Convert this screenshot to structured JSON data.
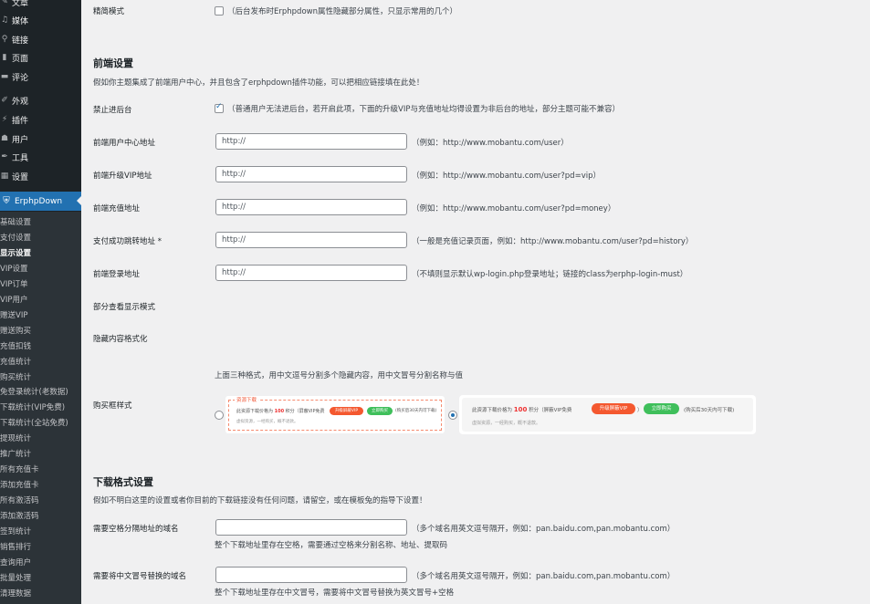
{
  "sidebar": {
    "top_items": [
      {
        "label": "文章",
        "icon": "pushpin-icon"
      },
      {
        "label": "媒体",
        "icon": "media-icon"
      },
      {
        "label": "链接",
        "icon": "link-icon"
      },
      {
        "label": "页面",
        "icon": "page-icon"
      },
      {
        "label": "评论",
        "icon": "comment-icon"
      },
      {
        "label": "外观",
        "icon": "brush-icon"
      },
      {
        "label": "插件",
        "icon": "plugin-icon"
      },
      {
        "label": "用户",
        "icon": "user-icon"
      },
      {
        "label": "工具",
        "icon": "wrench-icon"
      },
      {
        "label": "设置",
        "icon": "settings-icon"
      }
    ],
    "current": {
      "label": "ErphpDown",
      "icon": "shield-icon"
    },
    "submenu": [
      "基础设置",
      "支付设置",
      "显示设置",
      "VIP设置",
      "VIP订单",
      "VIP用户",
      "赠送VIP",
      "赠送购买",
      "充值扣钱",
      "充值统计",
      "购买统计",
      "免登录统计(老数据)",
      "下载统计(VIP免费)",
      "下载统计(全站免费)",
      "提现统计",
      "推广统计",
      "所有充值卡",
      "添加充值卡",
      "所有激活码",
      "添加激活码",
      "签到统计",
      "销售排行",
      "查询用户",
      "批量处理",
      "清理数据"
    ],
    "active_submenu": "显示设置"
  },
  "simple_mode": {
    "label": "精简模式",
    "checked": false,
    "desc": "（后台发布时Erphpdown属性隐藏部分属性，只显示常用的几个）"
  },
  "frontend": {
    "title": "前端设置",
    "intro": "假如你主题集成了前端用户中心，并且包含了erphpdown插件功能，可以把相应链接填在此处！",
    "disable_admin": {
      "label": "禁止进后台",
      "checked": true,
      "desc": "（普通用户无法进后台，若开启此项，下面的升级VIP与充值地址均得设置为非后台的地址，部分主题可能不兼容）"
    },
    "fields": [
      {
        "label": "前端用户中心地址",
        "value": "http://",
        "desc": "（例如：http://www.mobantu.com/user）"
      },
      {
        "label": "前端升级VIP地址",
        "value": "http://",
        "desc": "（例如：http://www.mobantu.com/user?pd=vip）"
      },
      {
        "label": "前端充值地址",
        "value": "http://",
        "desc": "（例如：http://www.mobantu.com/user?pd=money）"
      },
      {
        "label": "支付成功跳转地址 *",
        "value": "http://",
        "desc": "（一般是充值记录页面，例如：http://www.mobantu.com/user?pd=history）"
      },
      {
        "label": "前端登录地址",
        "value": "http://",
        "desc": "（不填则显示默认wp-login.php登录地址；链接的class为erphp-login-must）"
      }
    ],
    "partial_view_label": "部分查看显示模式",
    "hidden_format_label": "隐藏内容格式化",
    "format_note": "上面三种格式，用中文逗号分割多个隐藏内容，用中文冒号分割名称与值",
    "buy_box": {
      "label": "购买框样式",
      "selected": 2,
      "style1": {
        "title": "资源下载",
        "price_prefix": "此资源下载价格为",
        "price": "100",
        "price_suffix": "积分（屏蔽VIP免费",
        "btn_vip": "升级屏蔽VIP",
        "btn_buy": "立即购买",
        "note": "(购买后30天内可下载)",
        "sub": "虚拟资源，一经购买，概不退款。"
      },
      "style2": {
        "price_prefix": "此资源下载价格为",
        "price": "100",
        "price_suffix": "积分（屏蔽VIP免费",
        "btn_vip": "升级屏蔽VIP",
        "close_paren": "）",
        "btn_buy": "立即购买",
        "note": "(购买后30天内可下载)",
        "sub": "虚拟资源，一经购买，概不退款。"
      }
    }
  },
  "download": {
    "title": "下载格式设置",
    "intro": "假如不明白这里的设置或者你目前的下载链接没有任何问题，请留空，或在模板兔的指导下设置！",
    "fields": [
      {
        "label": "需要空格分隔地址的域名",
        "value": "",
        "desc": "（多个域名用英文逗号隔开，例如：pan.baidu.com,pan.mobantu.com）",
        "help": "整个下载地址里存在空格，需要通过空格来分割名称、地址、提取码"
      },
      {
        "label": "需要将中文冒号替换的域名",
        "value": "",
        "desc": "（多个域名用英文逗号隔开，例如：pan.baidu.com,pan.mobantu.com）",
        "help": "整个下载地址里存在中文冒号，需要将中文冒号替换为英文冒号+空格"
      }
    ]
  }
}
